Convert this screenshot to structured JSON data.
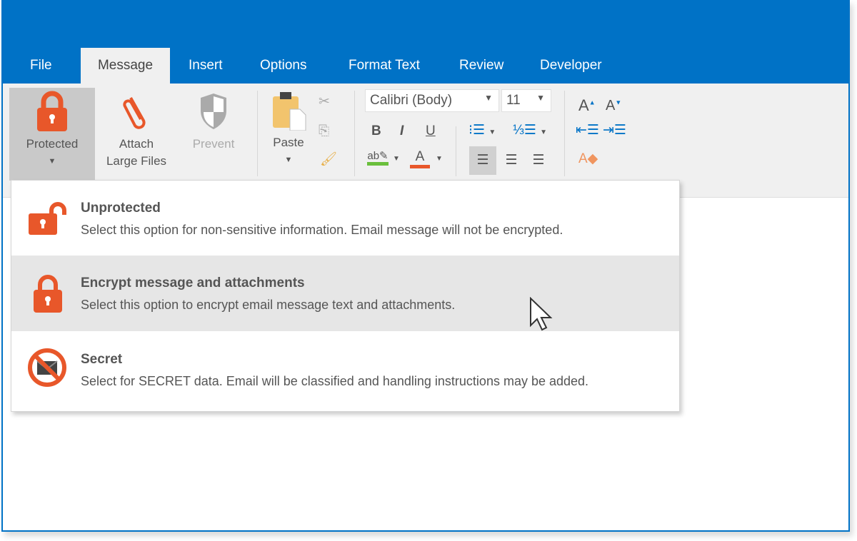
{
  "tabs": [
    "File",
    "Message",
    "Insert",
    "Options",
    "Format Text",
    "Review",
    "Developer"
  ],
  "active_tab": "Message",
  "ribbon": {
    "protected_label": "Protected",
    "attach_label_1": "Attach",
    "attach_label_2": "Large Files",
    "prevent_label": "Prevent",
    "paste_label": "Paste",
    "font_name": "Calibri (Body)",
    "font_size": "11",
    "bold": "B",
    "italic": "I",
    "underline": "U"
  },
  "menu": [
    {
      "title": "Unprotected",
      "desc": "Select this option for non-sensitive information. Email message will not be encrypted."
    },
    {
      "title": "Encrypt message and attachments",
      "desc": "Select this option to encrypt email message text and attachments."
    },
    {
      "title": "Secret",
      "desc": "Select for SECRET data. Email will be classified and handling instructions may be added."
    }
  ],
  "colors": {
    "accent": "#0072c6",
    "lock": "#e8572a",
    "highlight_bar": "#6abf3c",
    "fontcolor_bar": "#e8572a"
  }
}
